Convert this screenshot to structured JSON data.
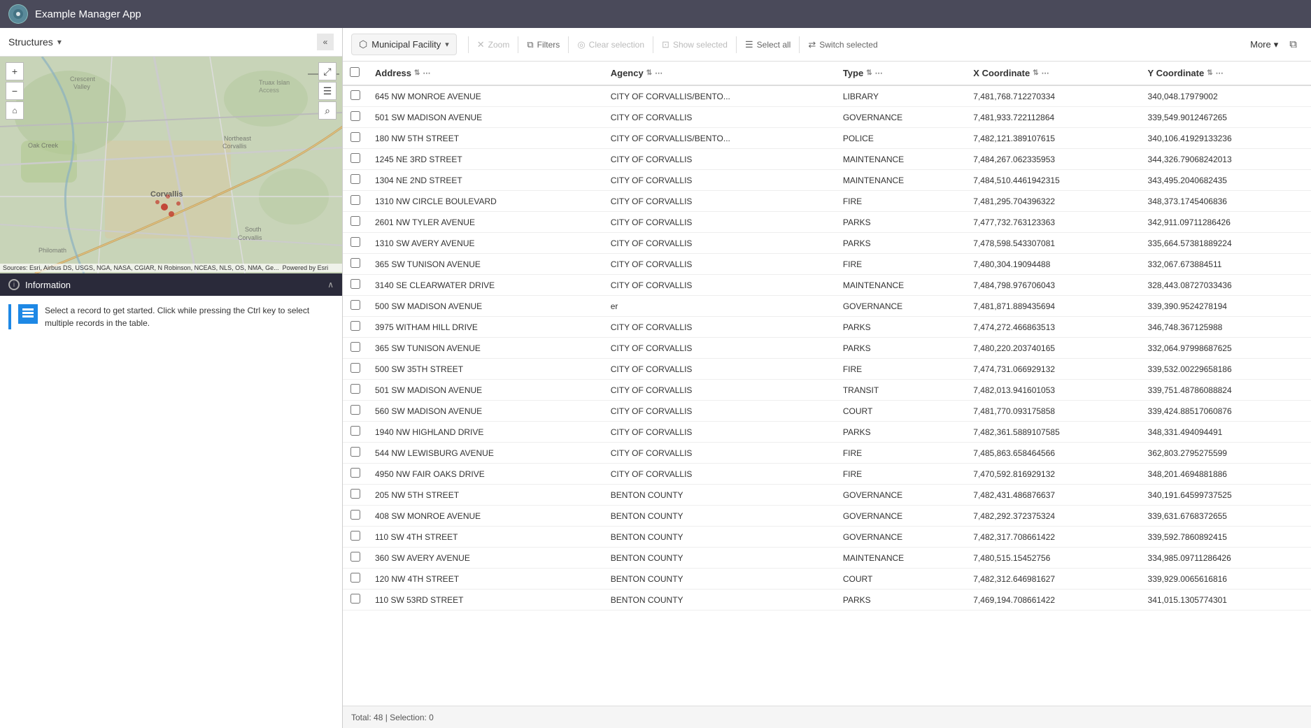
{
  "app": {
    "title": "Example Manager App"
  },
  "left_panel": {
    "structures_label": "Structures",
    "info_title": "Information",
    "info_text": "Select a record to get started. Click while pressing the Ctrl key to select multiple records in the table."
  },
  "map": {
    "attribution": "Sources: Esri, Airbus DS, USGS, NGA, NASA, CGIAR, N Robinson, NCEAS, NLS, OS, NMA, Ge...",
    "powered_by": "Powered by Esri"
  },
  "toolbar": {
    "layer_name": "Municipal Facility",
    "zoom_label": "Zoom",
    "filters_label": "Filters",
    "clear_selection_label": "Clear selection",
    "show_selected_label": "Show selected",
    "select_all_label": "Select all",
    "switch_selected_label": "Switch selected",
    "more_label": "More",
    "external_icon": "⧉"
  },
  "table": {
    "columns": [
      {
        "key": "checkbox",
        "label": ""
      },
      {
        "key": "address",
        "label": "Address"
      },
      {
        "key": "agency",
        "label": "Agency"
      },
      {
        "key": "type",
        "label": "Type"
      },
      {
        "key": "x_coord",
        "label": "X Coordinate"
      },
      {
        "key": "y_coord",
        "label": "Y Coordinate"
      }
    ],
    "rows": [
      {
        "address": "645 NW MONROE AVENUE",
        "agency": "CITY OF CORVALLIS/BENTO...",
        "type": "LIBRARY",
        "x": "7,481,768.712270334",
        "y": "340,048.17979002"
      },
      {
        "address": "501 SW MADISON AVENUE",
        "agency": "CITY OF CORVALLIS",
        "type": "GOVERNANCE",
        "x": "7,481,933.722112864",
        "y": "339,549.9012467265"
      },
      {
        "address": "180 NW 5TH STREET",
        "agency": "CITY OF CORVALLIS/BENTO...",
        "type": "POLICE",
        "x": "7,482,121.389107615",
        "y": "340,106.41929133236"
      },
      {
        "address": "1245 NE 3RD STREET",
        "agency": "CITY OF CORVALLIS",
        "type": "MAINTENANCE",
        "x": "7,484,267.062335953",
        "y": "344,326.79068242013"
      },
      {
        "address": "1304 NE 2ND STREET",
        "agency": "CITY OF CORVALLIS",
        "type": "MAINTENANCE",
        "x": "7,484,510.4461942315",
        "y": "343,495.2040682435"
      },
      {
        "address": "1310 NW CIRCLE BOULEVARD",
        "agency": "CITY OF CORVALLIS",
        "type": "FIRE",
        "x": "7,481,295.704396322",
        "y": "348,373.1745406836"
      },
      {
        "address": "2601 NW TYLER AVENUE",
        "agency": "CITY OF CORVALLIS",
        "type": "PARKS",
        "x": "7,477,732.763123363",
        "y": "342,911.09711286426"
      },
      {
        "address": "1310 SW AVERY AVENUE",
        "agency": "CITY OF CORVALLIS",
        "type": "PARKS",
        "x": "7,478,598.543307081",
        "y": "335,664.57381889224"
      },
      {
        "address": "365 SW TUNISON AVENUE",
        "agency": "CITY OF CORVALLIS",
        "type": "FIRE",
        "x": "7,480,304.19094488",
        "y": "332,067.673884511"
      },
      {
        "address": "3140 SE CLEARWATER DRIVE",
        "agency": "CITY OF CORVALLIS",
        "type": "MAINTENANCE",
        "x": "7,484,798.976706043",
        "y": "328,443.08727033436"
      },
      {
        "address": "500 SW MADISON AVENUE",
        "agency": "er",
        "type": "GOVERNANCE",
        "x": "7,481,871.889435694",
        "y": "339,390.9524278194"
      },
      {
        "address": "3975 WITHAM HILL DRIVE",
        "agency": "CITY OF CORVALLIS",
        "type": "PARKS",
        "x": "7,474,272.466863513",
        "y": "346,748.367125988"
      },
      {
        "address": "365 SW TUNISON AVENUE",
        "agency": "CITY OF CORVALLIS",
        "type": "PARKS",
        "x": "7,480,220.203740165",
        "y": "332,064.97998687625"
      },
      {
        "address": "500 SW 35TH STREET",
        "agency": "CITY OF CORVALLIS",
        "type": "FIRE",
        "x": "7,474,731.066929132",
        "y": "339,532.00229658186"
      },
      {
        "address": "501 SW MADISON AVENUE",
        "agency": "CITY OF CORVALLIS",
        "type": "TRANSIT",
        "x": "7,482,013.941601053",
        "y": "339,751.48786088824"
      },
      {
        "address": "560 SW MADISON AVENUE",
        "agency": "CITY OF CORVALLIS",
        "type": "COURT",
        "x": "7,481,770.093175858",
        "y": "339,424.88517060876"
      },
      {
        "address": "1940 NW HIGHLAND DRIVE",
        "agency": "CITY OF CORVALLIS",
        "type": "PARKS",
        "x": "7,482,361.5889107585",
        "y": "348,331.494094491"
      },
      {
        "address": "544 NW LEWISBURG AVENUE",
        "agency": "CITY OF CORVALLIS",
        "type": "FIRE",
        "x": "7,485,863.658464566",
        "y": "362,803.2795275599"
      },
      {
        "address": "4950 NW FAIR OAKS DRIVE",
        "agency": "CITY OF CORVALLIS",
        "type": "FIRE",
        "x": "7,470,592.816929132",
        "y": "348,201.4694881886"
      },
      {
        "address": "205 NW 5TH STREET",
        "agency": "BENTON COUNTY",
        "type": "GOVERNANCE",
        "x": "7,482,431.486876637",
        "y": "340,191.64599737525"
      },
      {
        "address": "408 SW MONROE AVENUE",
        "agency": "BENTON COUNTY",
        "type": "GOVERNANCE",
        "x": "7,482,292.372375324",
        "y": "339,631.6768372655"
      },
      {
        "address": "110 SW 4TH STREET",
        "agency": "BENTON COUNTY",
        "type": "GOVERNANCE",
        "x": "7,482,317.708661422",
        "y": "339,592.7860892415"
      },
      {
        "address": "360 SW AVERY AVENUE",
        "agency": "BENTON COUNTY",
        "type": "MAINTENANCE",
        "x": "7,480,515.15452756",
        "y": "334,985.09711286426"
      },
      {
        "address": "120 NW 4TH STREET",
        "agency": "BENTON COUNTY",
        "type": "COURT",
        "x": "7,482,312.646981627",
        "y": "339,929.0065616816"
      },
      {
        "address": "110 SW 53RD STREET",
        "agency": "BENTON COUNTY",
        "type": "PARKS",
        "x": "7,469,194.708661422",
        "y": "341,015.1305774301"
      }
    ],
    "status": "Total: 48 | Selection: 0"
  }
}
